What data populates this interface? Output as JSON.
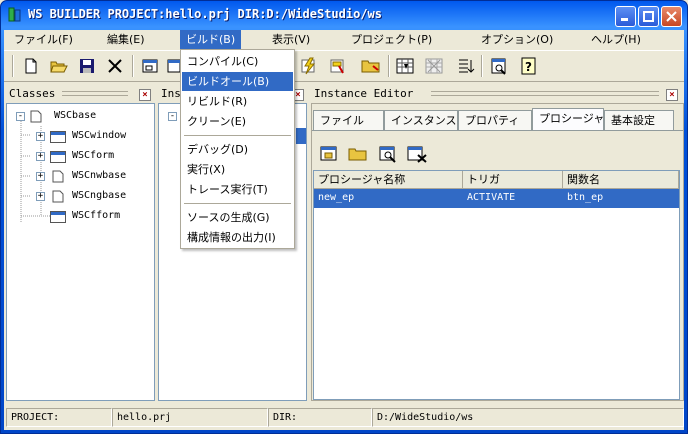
{
  "window": {
    "title": "WS BUILDER PROJECT:hello.prj DIR:D:/WideStudio/ws",
    "colors": {
      "titlebar": "#0054e3",
      "selection": "#316ac5",
      "menu_bg": "#ece9d8"
    }
  },
  "menubar": {
    "items": [
      {
        "label": "ファイル(F)"
      },
      {
        "label": "編集(E)"
      },
      {
        "label": "ビルド(B)"
      },
      {
        "label": "表示(V)"
      },
      {
        "label": "プロジェクト(P)"
      },
      {
        "label": "オプション(O)"
      },
      {
        "label": "ヘルプ(H)"
      }
    ],
    "active": "ビルド(B)"
  },
  "build_menu": {
    "items": [
      {
        "label": "コンパイル(C)"
      },
      {
        "label": "ビルドオール(B)"
      },
      {
        "label": "リビルド(R)"
      },
      {
        "label": "クリーン(E)"
      },
      {
        "label": "デバッグ(D)"
      },
      {
        "label": "実行(X)"
      },
      {
        "label": "トレース実行(T)"
      },
      {
        "label": "ソースの生成(G)"
      },
      {
        "label": "構成情報の出力(I)"
      }
    ],
    "highlighted": "ビルドオール(B)"
  },
  "toolbar": {
    "icons": [
      "new-file-icon",
      "open-folder-icon",
      "save-icon",
      "cut-icon",
      "window-icon",
      "window2-icon",
      "lightning-icon",
      "build-icon",
      "folder-icon",
      "grid-icon",
      "grid-disabled-icon",
      "list-icon",
      "preview-icon",
      "help-icon"
    ]
  },
  "classes_pane": {
    "title": "Classes",
    "tree": [
      {
        "label": "WSCbase",
        "level": 0,
        "expander": "-"
      },
      {
        "label": "WSCwindow",
        "level": 1,
        "expander": "+"
      },
      {
        "label": "WSCform",
        "level": 1,
        "expander": "+"
      },
      {
        "label": "WSCnwbase",
        "level": 1,
        "expander": "+"
      },
      {
        "label": "WSCngbase",
        "level": 1,
        "expander": "+"
      },
      {
        "label": "WSCfform",
        "level": 1,
        "expander": ""
      }
    ]
  },
  "instance_pane": {
    "title": "Ins"
  },
  "editor_pane": {
    "title": "Instance Editor",
    "tabs": [
      {
        "label": "ファイル"
      },
      {
        "label": "インスタンス"
      },
      {
        "label": "プロパティ"
      },
      {
        "label": "プロシージャ"
      },
      {
        "label": "基本設定"
      }
    ],
    "selected_tab": "プロシージャ",
    "table": {
      "headers": [
        "プロシージャ名称",
        "トリガ",
        "関数名"
      ],
      "rows": [
        [
          "new_ep",
          "ACTIVATE",
          "btn_ep"
        ]
      ]
    }
  },
  "statusbar": {
    "project_label": "PROJECT:",
    "project_value": "hello.prj",
    "dir_label": "DIR:",
    "dir_value": "D:/WideStudio/ws"
  }
}
